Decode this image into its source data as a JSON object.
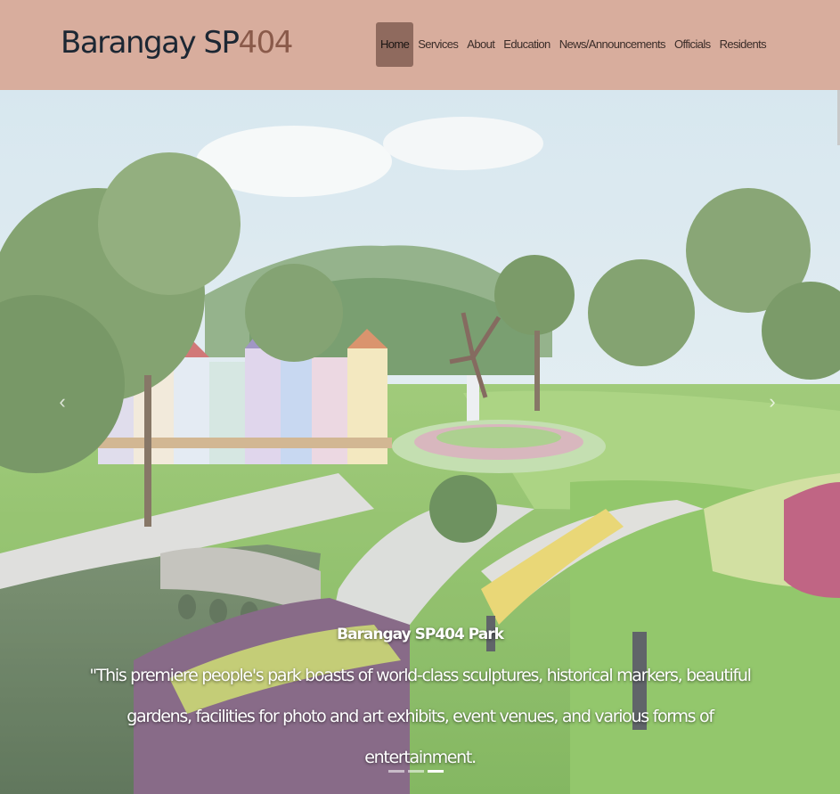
{
  "brand": {
    "prefix": "Barangay SP",
    "suffix": "404"
  },
  "nav": {
    "items": [
      {
        "label": "Home",
        "active": true
      },
      {
        "label": "Services"
      },
      {
        "label": "About"
      },
      {
        "label": "Education"
      },
      {
        "label": "News/Announcements"
      },
      {
        "label": "Officials"
      },
      {
        "label": "Residents"
      }
    ]
  },
  "carousel": {
    "prev_icon": "chevron-left-icon",
    "next_icon": "chevron-right-icon",
    "slide": {
      "title": "Barangay SP404 Park",
      "text": "\"This premiere people's park boasts of world-class sculptures, historical markers, beautiful gardens, facilities for photo and art exhibits, event venues, and various forms of entertainment."
    },
    "indicator_count": 3,
    "active_indicator": 2
  },
  "colors": {
    "navbar": "#d8ad9d",
    "brand_text": "#1c2733",
    "brand_accent": "#8a5a4a",
    "active_nav": "#8f6a5e"
  }
}
